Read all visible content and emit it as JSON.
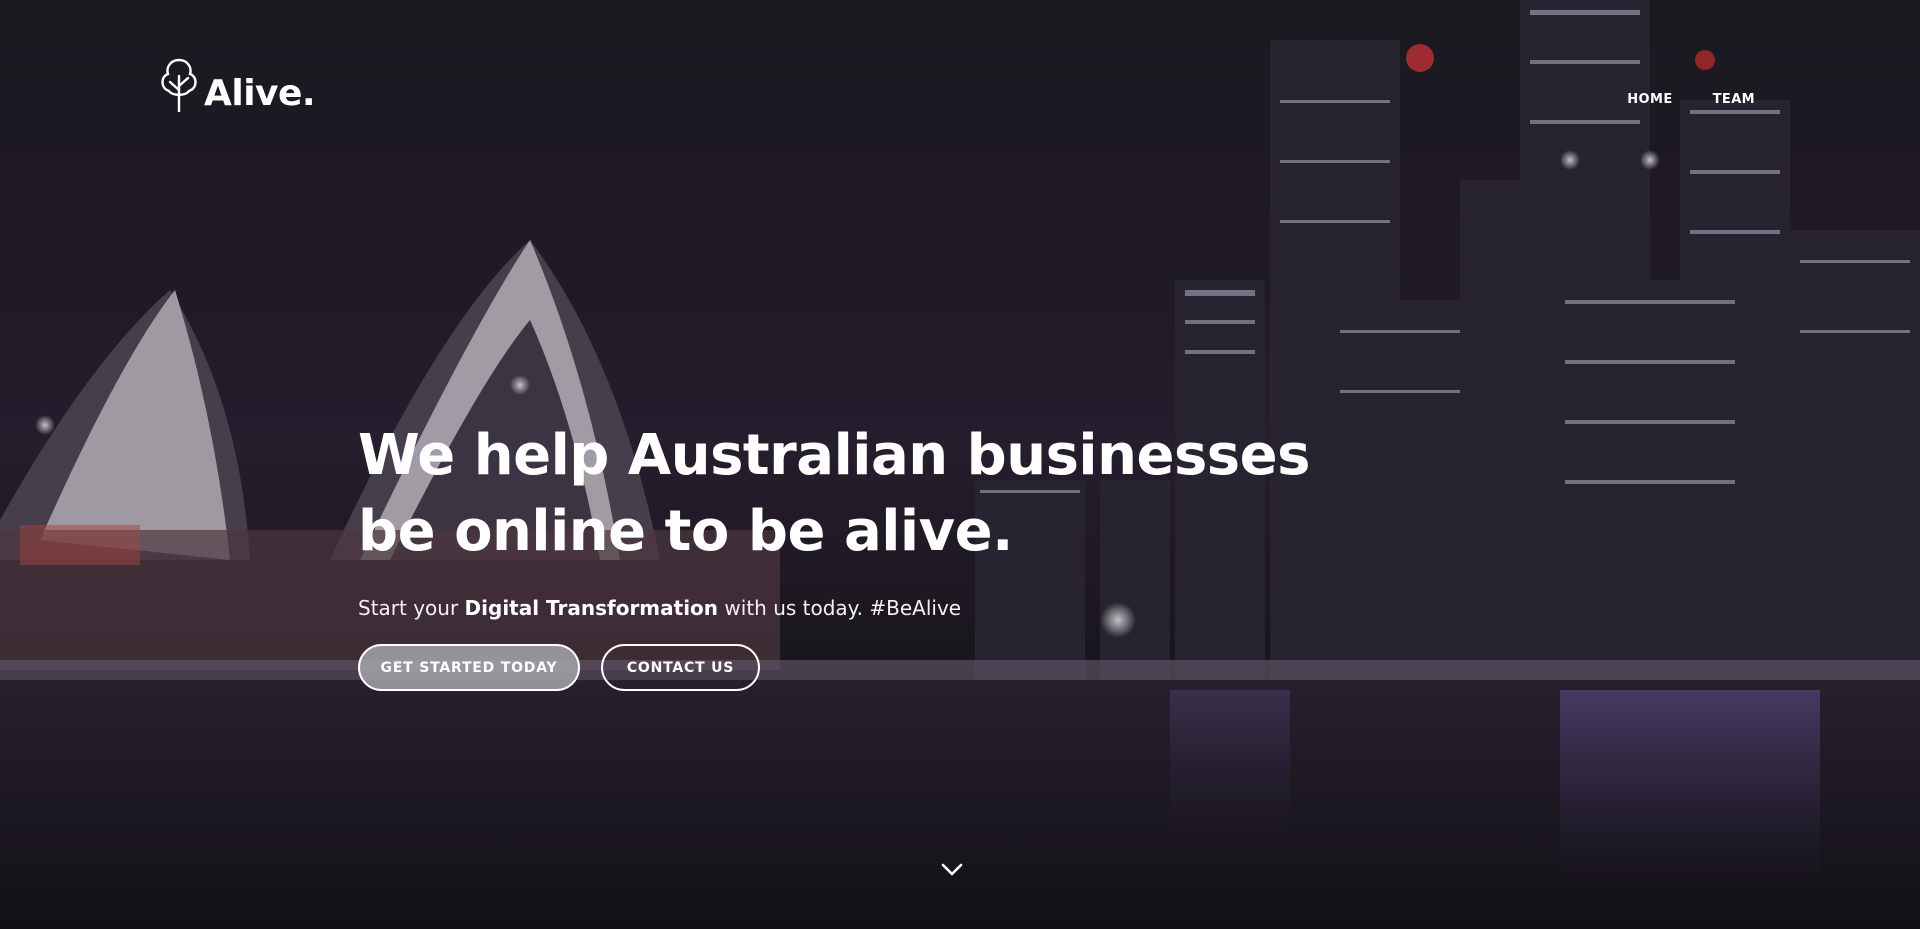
{
  "brand": {
    "name": "Alive.",
    "logo_icon": "tree-icon"
  },
  "nav": {
    "items": [
      {
        "label": "HOME"
      },
      {
        "label": "TEAM"
      }
    ]
  },
  "hero": {
    "headline_line1": "We help Australian businesses",
    "headline_line2": "be online to be alive.",
    "subline_prefix": "Start your ",
    "subline_bold": "Digital Transformation",
    "subline_suffix": " with us today. #BeAlive",
    "primary_button": "GET STARTED TODAY",
    "secondary_button": "CONTACT US",
    "scroll_icon": "chevron-down-icon",
    "background": "sydney-harbour-night-skyline"
  },
  "colors": {
    "primary_button_bg": "#a5a5aa",
    "text": "#ffffff",
    "background": "#1d1b23"
  }
}
